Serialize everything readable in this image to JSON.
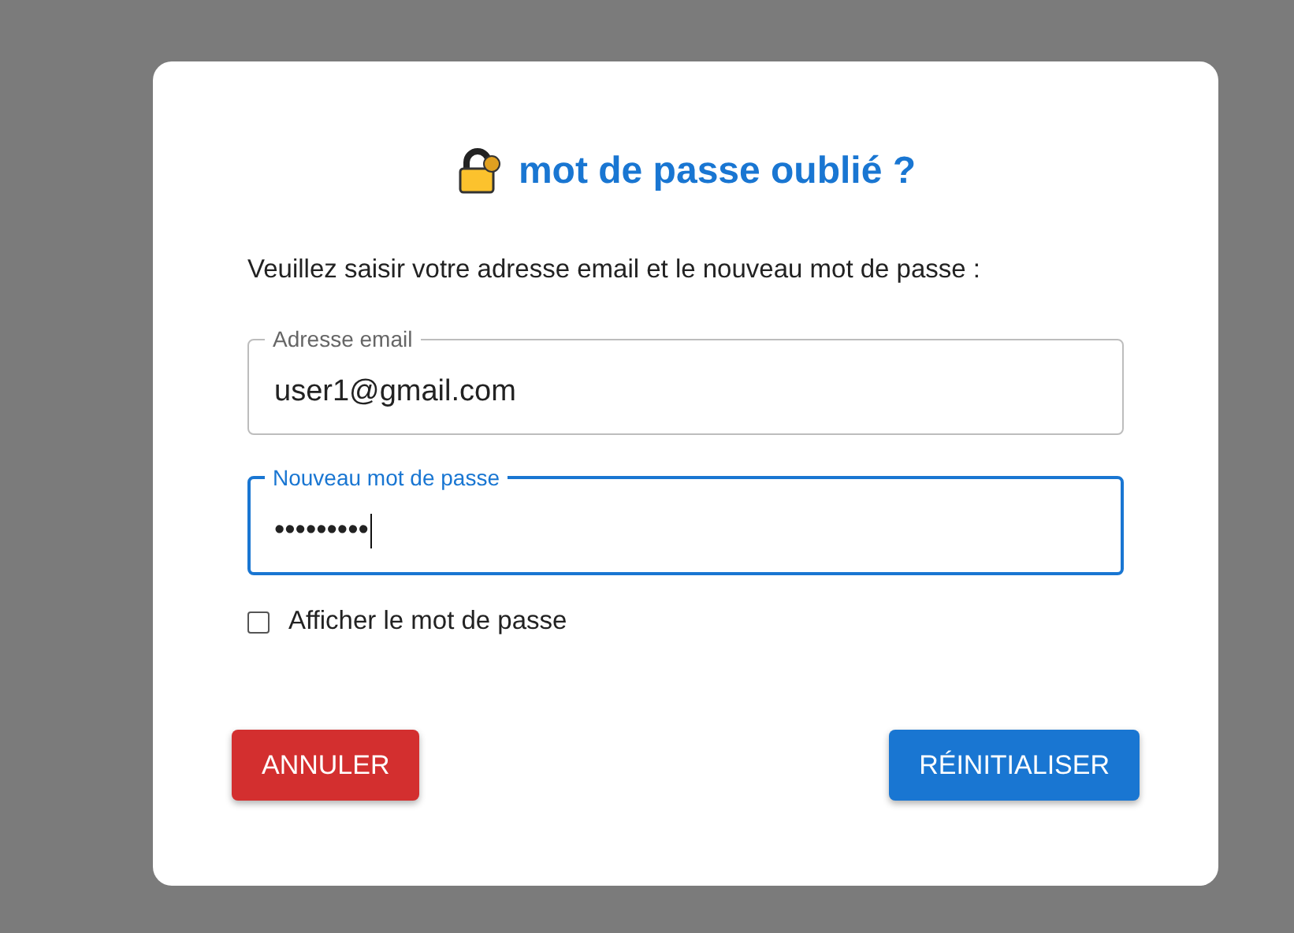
{
  "dialog": {
    "title": "mot de passe oublié ?",
    "instruction": "Veuillez saisir votre adresse email et le nouveau mot de passe :",
    "fields": [
      {
        "label": "Adresse email",
        "value": "user1@gmail.com",
        "focused": false
      },
      {
        "label": "Nouveau mot de passe",
        "value": "•••••••••",
        "focused": true
      }
    ],
    "show_password": {
      "label": "Afficher le mot de passe",
      "checked": false
    },
    "buttons": [
      {
        "label": "ANNULER",
        "kind": "cancel"
      },
      {
        "label": "RÉINITIALISER",
        "kind": "primary"
      }
    ]
  }
}
